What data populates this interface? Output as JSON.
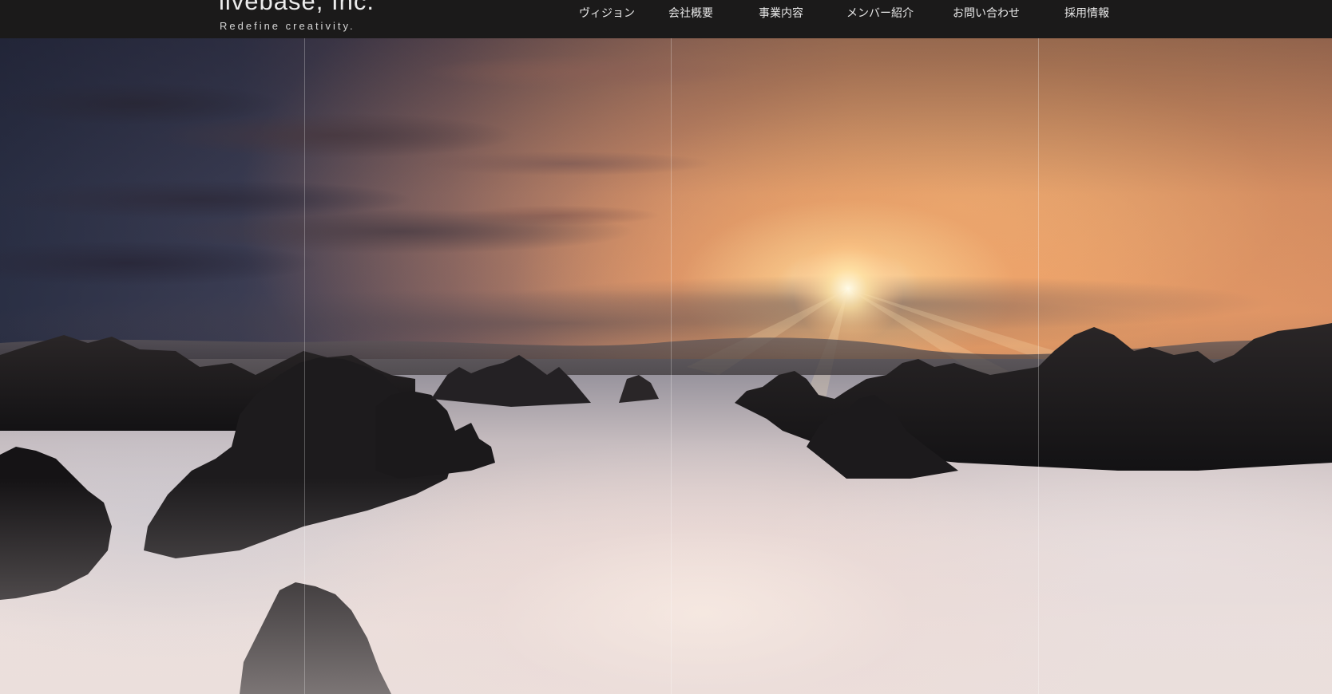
{
  "header": {
    "brand_name": "livebase, Inc.",
    "tagline": "Redefine creativity.",
    "background_color": "#1b1a1a"
  },
  "nav": {
    "items": [
      {
        "label": "ヴィジョン"
      },
      {
        "label": "会社概要"
      },
      {
        "label": "事業内容"
      },
      {
        "label": "メンバー紹介"
      },
      {
        "label": "お問い合わせ"
      },
      {
        "label": "採用情報"
      }
    ]
  },
  "hero": {
    "accent_sunrise": "#ffe6b0",
    "peak_color": "#1e1c1f"
  }
}
